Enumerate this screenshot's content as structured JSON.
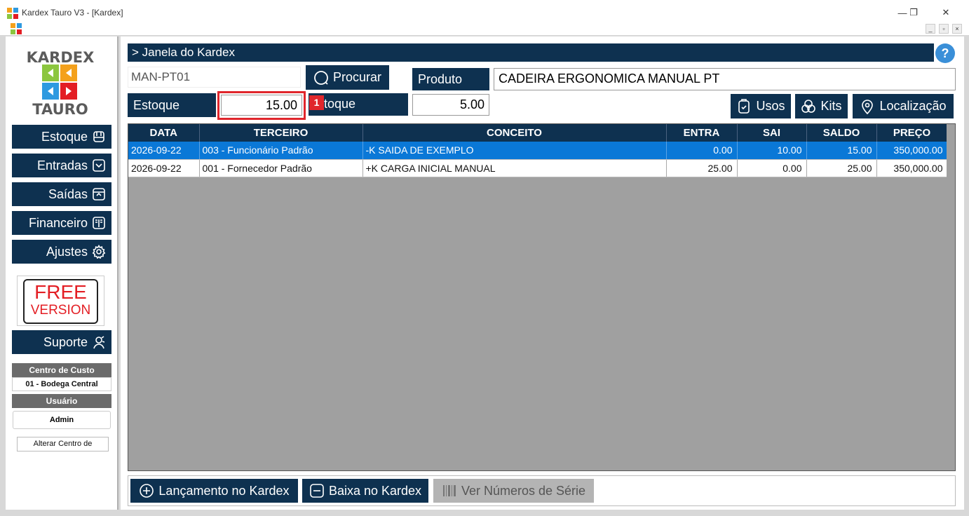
{
  "window": {
    "title": "Kardex Tauro V3 - [Kardex]",
    "minimize": "—",
    "maximize": "❐",
    "close": "✕"
  },
  "mdi": {
    "min": "_",
    "restore": "▫",
    "close": "×"
  },
  "logo": {
    "top": "KARDEX",
    "bottom": "TAURO"
  },
  "nav": [
    {
      "label": "Estoque",
      "icon": "box-icon"
    },
    {
      "label": "Entradas",
      "icon": "inbox-down-icon"
    },
    {
      "label": "Saídas",
      "icon": "inbox-up-icon"
    },
    {
      "label": "Financeiro",
      "icon": "book-icon"
    },
    {
      "label": "Ajustes",
      "icon": "gear-icon"
    }
  ],
  "free": {
    "line1": "FREE",
    "line2": "VERSION"
  },
  "support": {
    "label": "Suporte",
    "icon": "support-icon"
  },
  "cost_center": {
    "heading": "Centro de Custo",
    "value": "01 - Bodega Central"
  },
  "user": {
    "heading": "Usuário",
    "value": "Admin"
  },
  "alter_button": "Alterar Centro de",
  "header": {
    "title": "> Janela do Kardex",
    "help": "?"
  },
  "search": {
    "code": "MAN-PT01",
    "button": "Procurar"
  },
  "product": {
    "label": "Produto",
    "value": "CADEIRA ERGONOMICA MANUAL PT"
  },
  "stock": {
    "label": "Estoque",
    "value": "15.00"
  },
  "min_stock": {
    "label": "toque",
    "value": "5.00"
  },
  "badge": "1",
  "actions": {
    "usos": "Usos",
    "kits": "Kits",
    "localizacao": "Localização"
  },
  "table": {
    "columns": [
      "DATA",
      "TERCEIRO",
      "CONCEITO",
      "ENTRA",
      "SAI",
      "SALDO",
      "PREÇO"
    ],
    "rows": [
      [
        "2026-09-22",
        "003 - Funcionário Padrão",
        "-K SAIDA DE EXEMPLO",
        "0.00",
        "10.00",
        "15.00",
        "350,000.00"
      ],
      [
        "2026-09-22",
        "001 - Fornecedor Padrão",
        "+K CARGA INICIAL MANUAL",
        "25.00",
        "0.00",
        "25.00",
        "350,000.00"
      ]
    ]
  },
  "footer": {
    "launch": "Lançamento no Kardex",
    "lower": "Baixa no Kardex",
    "serials": "Ver Números de Série"
  },
  "colors": {
    "navy": "#0e3150",
    "selection": "#0a78d7",
    "highlight": "#e0262c",
    "grid_bg": "#a0a0a0"
  }
}
